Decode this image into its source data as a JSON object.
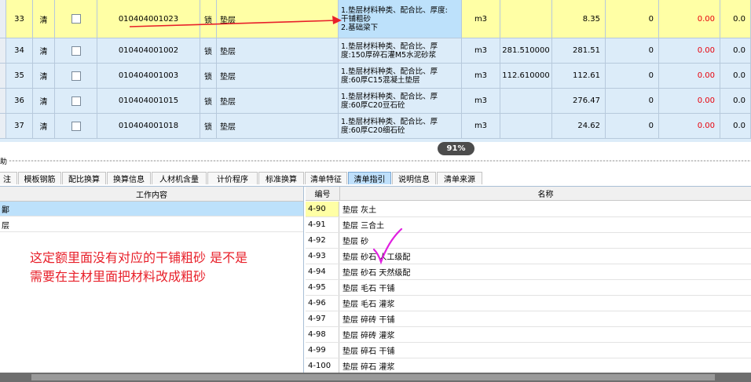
{
  "grid": {
    "rows": [
      {
        "no": "33",
        "type": "清",
        "code": "010404001023",
        "lock": "锁",
        "name": "垫层",
        "desc": [
          "1.垫层材料种类、配合比、厚度:",
          "干铺粗砂",
          "2.基础梁下"
        ],
        "unit": "m3",
        "qty": "",
        "total": "8.35",
        "zero": "0",
        "price": "0.00",
        "last": "0.0"
      },
      {
        "no": "34",
        "type": "清",
        "code": "010404001002",
        "lock": "锁",
        "name": "垫层",
        "desc": [
          "1.垫层材料种类、配合比、厚",
          "度:150厚碎石灌M5水泥砂浆"
        ],
        "unit": "m3",
        "qty": "281.510000",
        "total": "281.51",
        "zero": "0",
        "price": "0.00",
        "last": "0.0"
      },
      {
        "no": "35",
        "type": "清",
        "code": "010404001003",
        "lock": "锁",
        "name": "垫层",
        "desc": [
          "1.垫层材料种类、配合比、厚",
          "度:60厚C15混凝土垫层"
        ],
        "unit": "m3",
        "qty": "112.610000",
        "total": "112.61",
        "zero": "0",
        "price": "0.00",
        "last": "0.0"
      },
      {
        "no": "36",
        "type": "清",
        "code": "010404001015",
        "lock": "锁",
        "name": "垫层",
        "desc": [
          "1.垫层材料种类、配合比、厚",
          "度:60厚C20豆石砼"
        ],
        "unit": "m3",
        "qty": "",
        "total": "276.47",
        "zero": "0",
        "price": "0.00",
        "last": "0.0"
      },
      {
        "no": "37",
        "type": "清",
        "code": "010404001018",
        "lock": "锁",
        "name": "垫层",
        "desc": [
          "1.垫层材料种类、配合比、厚",
          "度:60厚C20细石砼"
        ],
        "unit": "m3",
        "qty": "",
        "total": "24.62",
        "zero": "0",
        "price": "0.00",
        "last": "0.0"
      }
    ]
  },
  "zoom": "91%",
  "splitter_label": "助",
  "tabs": [
    "注",
    "模板钢筋",
    "配比换算",
    "换算信息",
    "人材机含量",
    "计价程序",
    "标准换算",
    "清单特征",
    "清单指引",
    "说明信息",
    "清单来源"
  ],
  "active_tab": "清单指引",
  "left": {
    "header": "工作内容",
    "items": [
      "鄙",
      "层"
    ],
    "comment_lines": [
      "这定额里面没有对应的干铺粗砂 是不是",
      "需要在主材里面把材料改成粗砂"
    ]
  },
  "right": {
    "header_code": "编号",
    "header_name": "名称",
    "rows": [
      {
        "code": "4-90",
        "name": "垫层 灰土"
      },
      {
        "code": "4-91",
        "name": "垫层 三合土"
      },
      {
        "code": "4-92",
        "name": "垫层 砂"
      },
      {
        "code": "4-93",
        "name": "垫层 砂石 人工级配"
      },
      {
        "code": "4-94",
        "name": "垫层 砂石 天然级配"
      },
      {
        "code": "4-95",
        "name": "垫层 毛石 干铺"
      },
      {
        "code": "4-96",
        "name": "垫层 毛石 灌浆"
      },
      {
        "code": "4-97",
        "name": "垫层 碎砖 干铺"
      },
      {
        "code": "4-98",
        "name": "垫层 碎砖 灌浆"
      },
      {
        "code": "4-99",
        "name": "垫层 碎石 干铺"
      },
      {
        "code": "4-100",
        "name": "垫层 碎石 灌浆"
      }
    ]
  },
  "colors": {
    "red_text": "#e8000b",
    "selected_row": "#ffffa5",
    "highlight_cell": "#bde1fb",
    "arrow": "#e8202a",
    "checkmark": "#e020e0"
  }
}
